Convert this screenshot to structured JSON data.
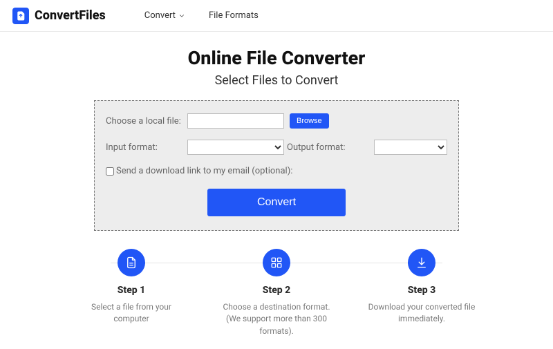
{
  "header": {
    "brand": "ConvertFiles",
    "nav": {
      "convert": "Convert",
      "formats": "File Formats"
    }
  },
  "hero": {
    "title": "Online File Converter",
    "subtitle": "Select Files to Convert"
  },
  "panel": {
    "localFileLabel": "Choose a local file:",
    "browse": "Browse",
    "inputFormatLabel": "Input format:",
    "outputFormatLabel": "Output format:",
    "emailLabel": "Send a download link to my email (optional):",
    "convert": "Convert"
  },
  "steps": [
    {
      "title": "Step 1",
      "text": "Select a file from your computer"
    },
    {
      "title": "Step 2",
      "text": "Choose a destination format. (We support more than 300 formats)."
    },
    {
      "title": "Step 3",
      "text": "Download your converted file immediately."
    }
  ]
}
